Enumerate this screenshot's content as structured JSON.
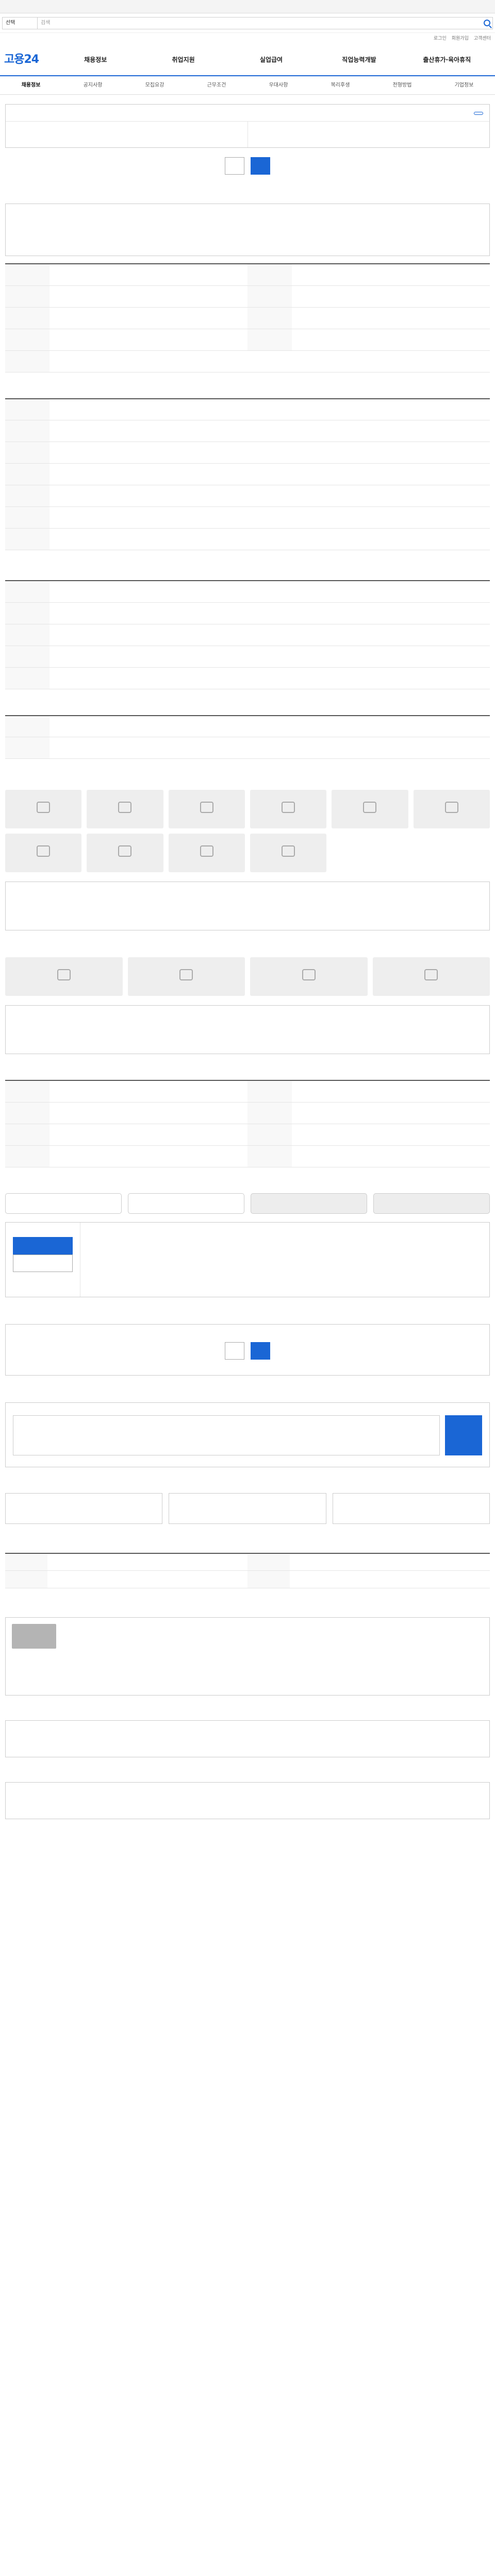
{
  "top_alert": "",
  "search": {
    "select": "선택",
    "placeholder": "검색"
  },
  "header": {
    "util_links": [
      "로그인",
      "회원가입",
      "고객센터"
    ],
    "logo": "고용24",
    "nav": [
      "채용정보",
      "취업지원",
      "실업급여",
      "직업능력개발",
      "출산휴가·육아휴직"
    ],
    "subnav": [
      "채용정보",
      "공지사항",
      "모집요강",
      "근무조건",
      "우대사항",
      "복리후생",
      "전형방법",
      "기업정보"
    ]
  },
  "job": {
    "category": "",
    "title": "",
    "tag": "",
    "company_section": "",
    "conditions_section": "",
    "company_rows": [
      {
        "k": "",
        "v": ""
      },
      {
        "k": "",
        "v": ""
      },
      {
        "k": "",
        "v": ""
      }
    ],
    "conditions_rows": [
      {
        "k": "",
        "v": ""
      },
      {
        "k": "",
        "v": ""
      },
      {
        "k": "",
        "v": ""
      }
    ],
    "buttons": {
      "interest": "",
      "apply": ""
    },
    "apply_note": ""
  },
  "recruitment": {
    "title": "",
    "description": "",
    "rows": [
      {
        "k": "",
        "v": "",
        "k2": "",
        "v2": ""
      },
      {
        "k": "",
        "v": "",
        "k2": "",
        "v2": ""
      },
      {
        "k": "",
        "v": "",
        "k2": "",
        "v2": ""
      },
      {
        "k": "",
        "v": "",
        "k2": "",
        "v2": ""
      },
      {
        "k": "",
        "v": ""
      }
    ]
  },
  "work": {
    "title": "",
    "rows": [
      {
        "k": "",
        "v": ""
      },
      {
        "k": "",
        "v": ""
      },
      {
        "k": "",
        "v": ""
      },
      {
        "k": "",
        "v": ""
      },
      {
        "k": "",
        "v": ""
      },
      {
        "k": "",
        "v": ""
      },
      {
        "k": "",
        "v": ""
      }
    ],
    "note": ""
  },
  "preferred": {
    "title": "",
    "rows": [
      {
        "k": "",
        "v": ""
      },
      {
        "k": "",
        "v": ""
      },
      {
        "k": "",
        "v": ""
      },
      {
        "k": "",
        "v": ""
      },
      {
        "k": "",
        "v": ""
      }
    ]
  },
  "other": {
    "title": "",
    "rows": [
      {
        "k": "",
        "v": ""
      },
      {
        "k": "",
        "v": ""
      }
    ],
    "extra": ""
  },
  "welfare": {
    "title": "",
    "tiles": [
      "",
      "",
      "",
      "",
      "",
      "",
      "",
      "",
      "",
      ""
    ],
    "list_title": ""
  },
  "facility": {
    "title": "",
    "tiles": [
      "",
      "",
      "",
      ""
    ],
    "list_title": ""
  },
  "work_env": {
    "title": "",
    "rows": [
      {
        "k": "",
        "v": "",
        "k2": "",
        "v2": ""
      },
      {
        "k": "",
        "v": "",
        "k2": "",
        "v2": ""
      },
      {
        "k": "",
        "v": "",
        "k2": "",
        "v2": ""
      },
      {
        "k": "",
        "v": "",
        "k2": "",
        "v2": ""
      }
    ]
  },
  "process": {
    "title": "",
    "steps": [
      "",
      "",
      "",
      ""
    ],
    "left_title": "",
    "left_text": "",
    "left_button_1": "",
    "left_button_2": "",
    "right_title": "",
    "right_text": ""
  },
  "manager": {
    "title": "",
    "warning": "",
    "message": "",
    "button_1": "",
    "button_2": ""
  },
  "qa": {
    "title": "",
    "placeholder": "",
    "submit": "",
    "note": ""
  },
  "status": {
    "title": "",
    "items": [
      {
        "label": "",
        "value": ""
      },
      {
        "label": "",
        "value": ""
      },
      {
        "label": "",
        "value": ""
      }
    ],
    "note": ""
  },
  "agency": {
    "title": "",
    "rows": [
      {
        "k": "",
        "v": "",
        "k2": "",
        "v2": ""
      },
      {
        "k": "",
        "v": "",
        "k2": "",
        "v2": ""
      }
    ],
    "note": ""
  },
  "company": {
    "title": "",
    "name": "",
    "rows": [
      {
        "k": "",
        "v": ""
      },
      {
        "k": "",
        "v": ""
      },
      {
        "k": "",
        "v": ""
      },
      {
        "k": "",
        "v": ""
      },
      {
        "k": "",
        "v": ""
      },
      {
        "k": "",
        "v": ""
      }
    ]
  },
  "related": {
    "title": "",
    "empty": ""
  },
  "recommend": {
    "title": "",
    "empty": ""
  },
  "colors": {
    "primary": "#1a66d5",
    "border": "#cccccc",
    "tile": "#eeeeee"
  }
}
